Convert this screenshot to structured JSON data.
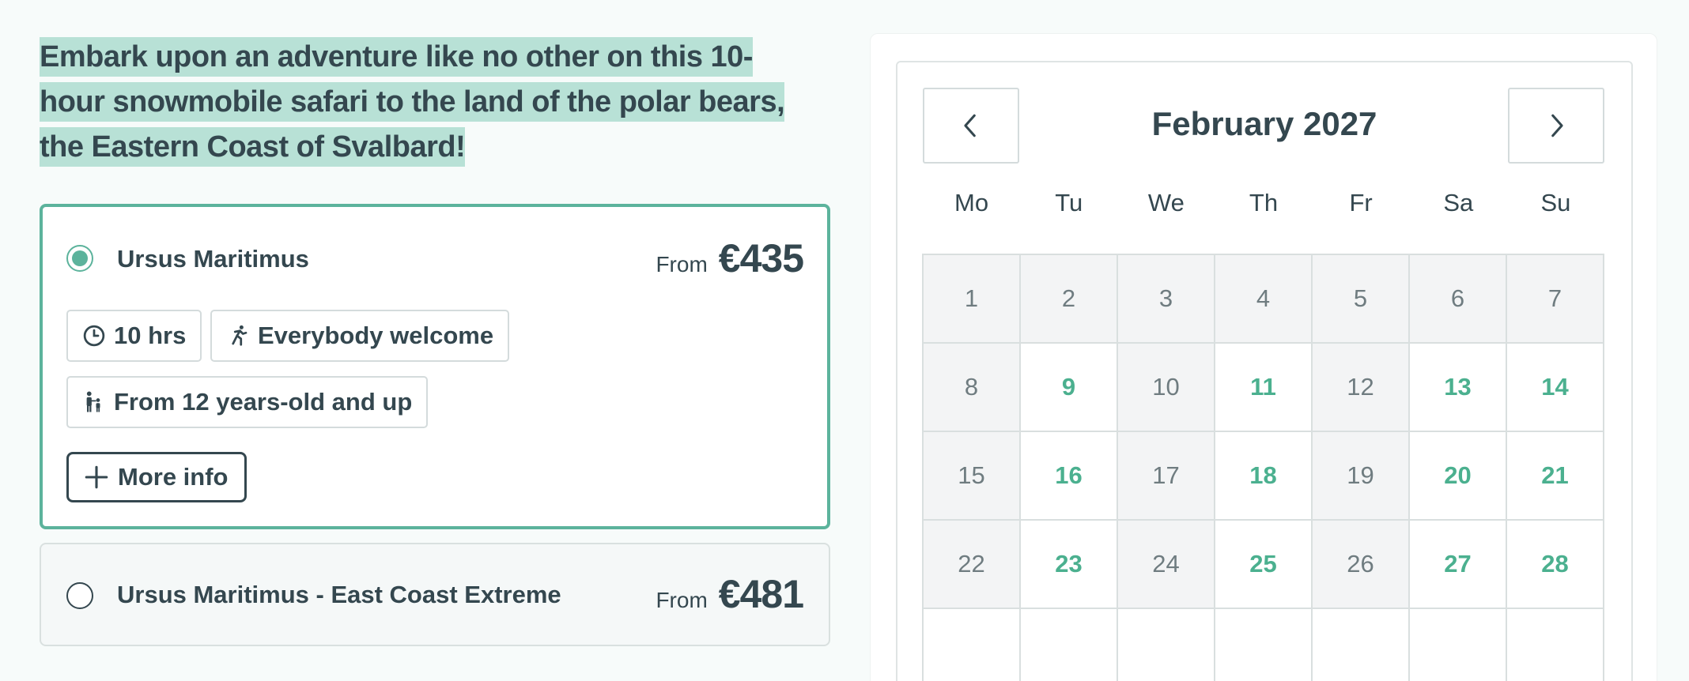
{
  "description": "Embark upon an adventure like no other on this 10-hour snowmobile safari to the land of the polar bears, the Eastern Coast of Svalbard!",
  "options": [
    {
      "title": "Ursus Maritimus",
      "from_label": "From",
      "price": "€435",
      "selected": true,
      "chips": [
        {
          "icon": "clock-icon",
          "label": "10 hrs"
        },
        {
          "icon": "person-running-icon",
          "label": "Everybody welcome"
        },
        {
          "icon": "family-icon",
          "label": "From 12 years-old and up"
        }
      ],
      "more_info_label": "More info"
    },
    {
      "title": "Ursus Maritimus - East Coast Extreme",
      "from_label": "From",
      "price": "€481",
      "selected": false
    }
  ],
  "calendar": {
    "month_label": "February 2027",
    "weekdays": [
      "Mo",
      "Tu",
      "We",
      "Th",
      "Fr",
      "Sa",
      "Su"
    ],
    "days": [
      {
        "d": "1",
        "available": false
      },
      {
        "d": "2",
        "available": false
      },
      {
        "d": "3",
        "available": false
      },
      {
        "d": "4",
        "available": false
      },
      {
        "d": "5",
        "available": false
      },
      {
        "d": "6",
        "available": false
      },
      {
        "d": "7",
        "available": false
      },
      {
        "d": "8",
        "available": false
      },
      {
        "d": "9",
        "available": true
      },
      {
        "d": "10",
        "available": false
      },
      {
        "d": "11",
        "available": true
      },
      {
        "d": "12",
        "available": false
      },
      {
        "d": "13",
        "available": true
      },
      {
        "d": "14",
        "available": true
      },
      {
        "d": "15",
        "available": false
      },
      {
        "d": "16",
        "available": true
      },
      {
        "d": "17",
        "available": false
      },
      {
        "d": "18",
        "available": true
      },
      {
        "d": "19",
        "available": false
      },
      {
        "d": "20",
        "available": true
      },
      {
        "d": "21",
        "available": true
      },
      {
        "d": "22",
        "available": false
      },
      {
        "d": "23",
        "available": true
      },
      {
        "d": "24",
        "available": false
      },
      {
        "d": "25",
        "available": true
      },
      {
        "d": "26",
        "available": false
      },
      {
        "d": "27",
        "available": true
      },
      {
        "d": "28",
        "available": true
      },
      {
        "d": "",
        "available": false
      },
      {
        "d": "",
        "available": false
      },
      {
        "d": "",
        "available": false
      },
      {
        "d": "",
        "available": false
      },
      {
        "d": "",
        "available": false
      },
      {
        "d": "",
        "available": false
      },
      {
        "d": "",
        "available": false
      }
    ]
  },
  "colors": {
    "accent": "#5cb39c",
    "highlight": "#b8e1d6",
    "text": "#34474f",
    "available_day": "#4bb08f",
    "unavailable_bg": "#f3f4f5"
  }
}
